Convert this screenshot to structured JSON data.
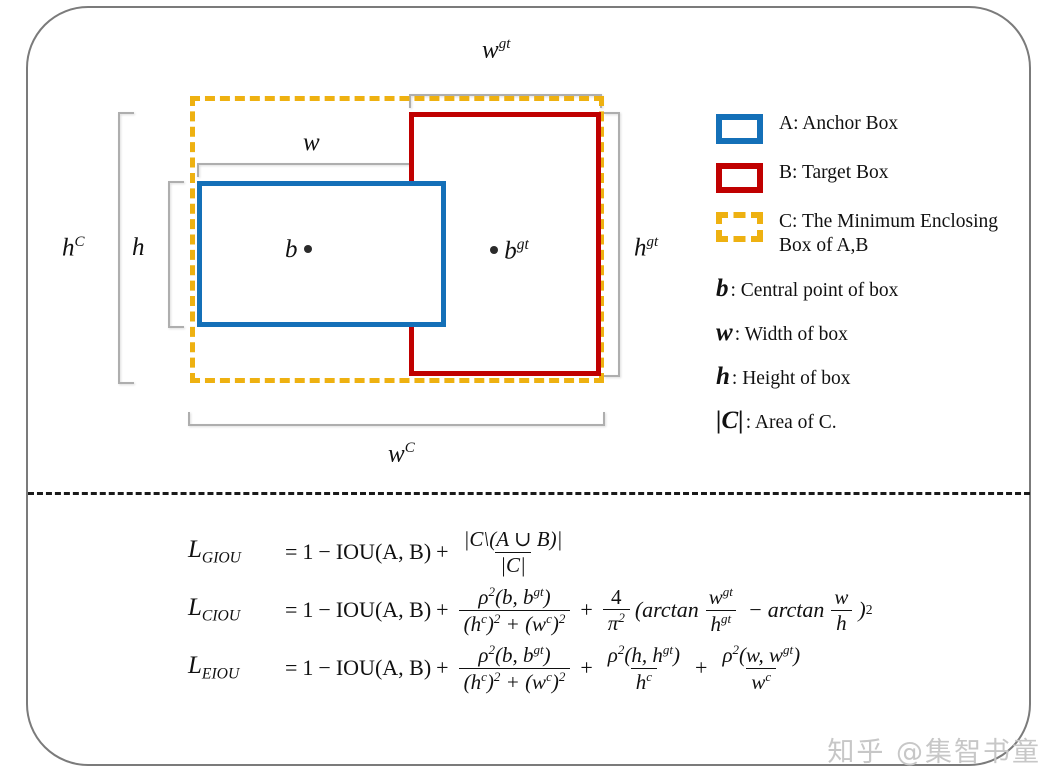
{
  "colors": {
    "anchor_blue": "#1470b8",
    "target_red": "#c00000",
    "enclosing_yellow": "#eeb111",
    "bracket_grey": "#aeaeae",
    "frame_grey": "#7b7b7b"
  },
  "diagram": {
    "dimension_labels": {
      "w": "w",
      "w_gt": "w",
      "w_gt_sup": "gt",
      "w_c": "w",
      "w_c_sup": "C",
      "h": "h",
      "h_c": "h",
      "h_c_sup": "C",
      "h_gt": "h",
      "h_gt_sup": "gt"
    },
    "center_points": {
      "anchor": "b",
      "target": "b",
      "target_sup": "gt"
    }
  },
  "legend": {
    "items": [
      {
        "swatch": "blue-solid-rect",
        "label": "A: Anchor Box"
      },
      {
        "swatch": "red-solid-rect",
        "label": "B: Target Box"
      },
      {
        "swatch": "yellow-dashed-rect",
        "label": "C: The Minimum Enclosing Box of A,B"
      }
    ],
    "definitions": [
      {
        "symbol": "b",
        "symbol_sup": "",
        "desc": ": Central point of box"
      },
      {
        "symbol": "w",
        "symbol_sup": "",
        "desc": ": Width of box"
      },
      {
        "symbol": "h",
        "symbol_sup": "",
        "desc": ": Height of box"
      },
      {
        "symbol": "|C|",
        "symbol_sup": "",
        "desc": ": Area of C."
      }
    ]
  },
  "formulas": {
    "giou": {
      "name": "L",
      "subscript": "GIOU",
      "eq": "=",
      "one": "1",
      "minus": "−",
      "iou": "IOU(A, B)",
      "plus": "+",
      "num1": "|C\\(A ∪ B)|",
      "den1": "|C|"
    },
    "ciou": {
      "name": "L",
      "subscript": "CIOU",
      "eq": "=",
      "one": "1",
      "minus": "−",
      "iou": "IOU(A, B)",
      "plus": "+",
      "num1_rho": "ρ",
      "num1_exp": "2",
      "num1_args": "(b, b",
      "num1_args_sup": "gt",
      "num1_args_end": ")",
      "den1_h": "(h",
      "den1_h_sup": "c",
      "den1_h_exp": ")",
      "den1_h_exp2": "2",
      "den1_plus": "+",
      "den1_w": "(w",
      "den1_w_sup": "c",
      "den1_w_exp2": "2",
      "plus2": "+",
      "frac2_num": "4",
      "frac2_den_pi": "π",
      "frac2_den_exp": "2",
      "open_paren": "(",
      "arctan1": "arctan",
      "f3_num": "w",
      "f3_num_sup": "gt",
      "f3_den": "h",
      "f3_den_sup": "gt",
      "minus2": "−",
      "arctan2": "arctan",
      "f4_num": "w",
      "f4_den": "h",
      "close_paren": ")",
      "close_exp": "2"
    },
    "eiou": {
      "name": "L",
      "subscript": "EIOU",
      "eq": "=",
      "one": "1",
      "minus": "−",
      "iou": "IOU(A, B)",
      "plus": "+",
      "num1_rho": "ρ",
      "num1_exp": "2",
      "num1_args": "(b, b",
      "num1_args_sup": "gt",
      "num1_args_end": ")",
      "den1_h": "(h",
      "den1_h_sup": "c",
      "den1_h_exp2": "2",
      "den1_plus": "+",
      "den1_w": "(w",
      "den1_w_sup": "c",
      "den1_w_exp2": "2",
      "plus2": "+",
      "f2_num_rho": "ρ",
      "f2_num_exp": "2",
      "f2_num_args": "(h, h",
      "f2_num_sup": "gt",
      "f2_num_end": ")",
      "f2_den": "h",
      "f2_den_sup": "c",
      "plus3": "+",
      "f3_num_rho": "ρ",
      "f3_num_exp": "2",
      "f3_num_args": "(w, w",
      "f3_num_sup": "gt",
      "f3_num_end": ")",
      "f3_den": "w",
      "f3_den_sup": "c"
    }
  },
  "watermark": {
    "text": "知乎 @集智书童"
  }
}
